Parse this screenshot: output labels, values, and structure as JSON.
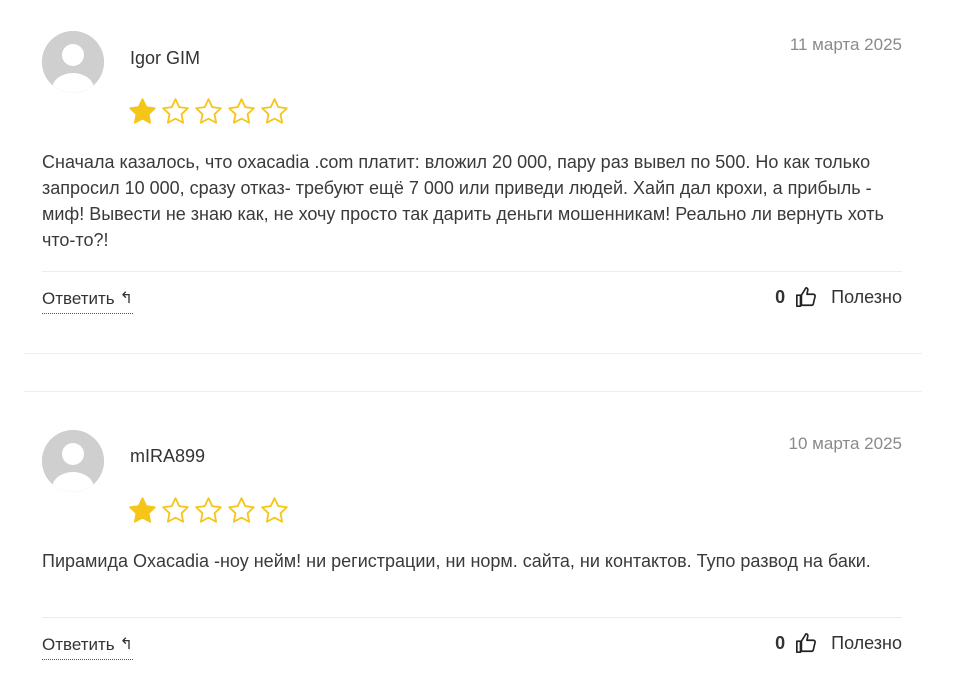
{
  "reviews": [
    {
      "author": "Igor GIM",
      "date": "11 марта 2025",
      "rating": 1,
      "rating_max": 5,
      "text": "Сначала казалось, что oxacadia .com платит: вложил 20 000, пару раз вывел по 500. Но как только запросил 10 000, сразу отказ- требуют ещё 7 000 или приведи людей. Хайп дал крохи, а прибыль - миф! Вывести не знаю как, не хочу просто так дарить деньги мошенникам! Реально ли вернуть хоть что-то?!",
      "reply_label": "Ответить",
      "helpful_count": "0",
      "helpful_label": "Полезно"
    },
    {
      "author": "mIRA899",
      "date": "10 марта 2025",
      "rating": 1,
      "rating_max": 5,
      "text": "Пирамида Oxacadia -ноу нейм! ни регистрации, ни норм. сайта, ни контактов. Тупо развод на баки.",
      "reply_label": "Ответить",
      "helpful_count": "0",
      "helpful_label": "Полезно"
    }
  ],
  "colors": {
    "star_filled": "#f5c518",
    "star_outline": "#f5c518",
    "avatar_bg": "#cfcfcf",
    "avatar_fg": "#ffffff",
    "date": "#8a8a8a"
  },
  "icons": {
    "avatar": "user-silhouette-icon",
    "star": "star-icon",
    "reply": "reply-arrow-icon",
    "helpful": "thumbs-up-icon"
  }
}
